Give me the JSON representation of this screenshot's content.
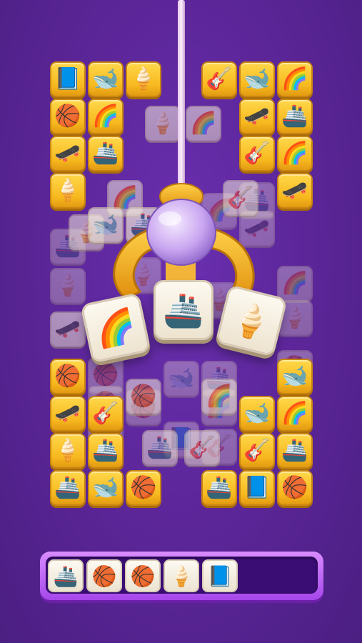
{
  "board": {
    "tiles": [
      {
        "icon": "book",
        "glyph": "📘",
        "kind": "gold",
        "pos": "r0c0"
      },
      {
        "icon": "whale",
        "glyph": "🐋",
        "kind": "gold",
        "pos": "r0c1"
      },
      {
        "icon": "ice-cream",
        "glyph": "🍦",
        "kind": "gold",
        "pos": "r0c2"
      },
      {
        "icon": "guitar",
        "glyph": "🎸",
        "kind": "gold",
        "pos": "r0c4"
      },
      {
        "icon": "whale",
        "glyph": "🐋",
        "kind": "gold",
        "pos": "r0c5"
      },
      {
        "icon": "rainbow",
        "glyph": "🌈",
        "kind": "gold",
        "pos": "r0c6"
      },
      {
        "icon": "basketball",
        "glyph": "🏀",
        "kind": "gold",
        "pos": "r1c0"
      },
      {
        "icon": "rainbow",
        "glyph": "🌈",
        "kind": "gold",
        "pos": "r1c1"
      },
      {
        "icon": "skateboard",
        "glyph": "🛹",
        "kind": "gold",
        "pos": "r1c5"
      },
      {
        "icon": "boat",
        "glyph": "🚢",
        "kind": "gold",
        "pos": "r1c6"
      },
      {
        "icon": "skateboard",
        "glyph": "🛹",
        "kind": "gold",
        "pos": "r2c0"
      },
      {
        "icon": "boat",
        "glyph": "🚢",
        "kind": "gold",
        "pos": "r2c1"
      },
      {
        "icon": "guitar",
        "glyph": "🎸",
        "kind": "gold",
        "pos": "r2c5"
      },
      {
        "icon": "rainbow",
        "glyph": "🌈",
        "kind": "gold",
        "pos": "r2c6"
      },
      {
        "icon": "ice-cream",
        "glyph": "🍦",
        "kind": "gold",
        "pos": "r3c0"
      },
      {
        "icon": "skateboard",
        "glyph": "🛹",
        "kind": "gold",
        "pos": "r3c6"
      },
      {
        "icon": "basketball",
        "glyph": "🏀",
        "kind": "gold",
        "pos": "r8c0"
      },
      {
        "icon": "whale",
        "glyph": "🐋",
        "kind": "gold",
        "pos": "r8c6"
      },
      {
        "icon": "skateboard",
        "glyph": "🛹",
        "kind": "gold",
        "pos": "r9c0"
      },
      {
        "icon": "guitar",
        "glyph": "🎸",
        "kind": "gold",
        "pos": "r9c1"
      },
      {
        "icon": "whale",
        "glyph": "🐋",
        "kind": "gold",
        "pos": "r9c5"
      },
      {
        "icon": "rainbow",
        "glyph": "🌈",
        "kind": "gold",
        "pos": "r9c6"
      },
      {
        "icon": "ice-cream",
        "glyph": "🍦",
        "kind": "gold",
        "pos": "r10c0"
      },
      {
        "icon": "boat",
        "glyph": "🚢",
        "kind": "gold",
        "pos": "r10c1"
      },
      {
        "icon": "guitar",
        "glyph": "🎸",
        "kind": "gold",
        "pos": "r10c5"
      },
      {
        "icon": "boat",
        "glyph": "🚢",
        "kind": "gold",
        "pos": "r10c6"
      },
      {
        "icon": "boat",
        "glyph": "🚢",
        "kind": "gold",
        "pos": "r11c0"
      },
      {
        "icon": "whale",
        "glyph": "🐋",
        "kind": "gold",
        "pos": "r11c1"
      },
      {
        "icon": "basketball",
        "glyph": "🏀",
        "kind": "gold",
        "pos": "r11c2"
      },
      {
        "icon": "boat",
        "glyph": "🚢",
        "kind": "gold",
        "pos": "r11c4"
      },
      {
        "icon": "book",
        "glyph": "📘",
        "kind": "gold",
        "pos": "r11c5"
      },
      {
        "icon": "basketball",
        "glyph": "🏀",
        "kind": "gold",
        "pos": "r11c6"
      }
    ],
    "covered_tiles": [
      {
        "icon": "ice-cream",
        "glyph": "🍦",
        "pos": "a1"
      },
      {
        "icon": "rainbow",
        "glyph": "🌈",
        "pos": "a2"
      },
      {
        "icon": "rainbow",
        "glyph": "🌈",
        "pos": "a3"
      },
      {
        "icon": "guitar",
        "glyph": "🎸",
        "pos": "a4"
      },
      {
        "icon": "ice-cream",
        "glyph": "🍦",
        "pos": "a5"
      },
      {
        "icon": "boat",
        "glyph": "🚢",
        "pos": "a6"
      },
      {
        "icon": "whale",
        "glyph": "🐋",
        "pos": "a7"
      },
      {
        "icon": "basketball",
        "glyph": "🏀",
        "pos": "a8"
      },
      {
        "icon": "rainbow",
        "glyph": "🌈",
        "pos": "a9"
      },
      {
        "icon": "boat",
        "glyph": "🚢",
        "pos": "a10"
      },
      {
        "icon": "guitar",
        "glyph": "🎸",
        "pos": "a11"
      }
    ],
    "faded_tiles": [
      {
        "icon": "ice-cream",
        "glyph": "🍦",
        "pos": "b1"
      },
      {
        "icon": "skateboard",
        "glyph": "🛹",
        "pos": "b2"
      },
      {
        "icon": "rainbow",
        "glyph": "🌈",
        "pos": "b3"
      },
      {
        "icon": "book",
        "glyph": "📘",
        "pos": "b4"
      },
      {
        "icon": "basketball",
        "glyph": "🏀",
        "pos": "b5"
      },
      {
        "icon": "ice-cream",
        "glyph": "🍦",
        "pos": "b6"
      },
      {
        "icon": "skateboard",
        "glyph": "🛹",
        "pos": "b7"
      },
      {
        "icon": "boat",
        "glyph": "🚢",
        "pos": "b8"
      },
      {
        "icon": "basketball",
        "glyph": "🏀",
        "pos": "b9"
      },
      {
        "icon": "whale",
        "glyph": "🐋",
        "pos": "b10"
      },
      {
        "icon": "basketball",
        "glyph": "🏀",
        "pos": "b11"
      },
      {
        "icon": "guitar",
        "glyph": "🎸",
        "pos": "b12"
      },
      {
        "icon": "rainbow",
        "glyph": "🌈",
        "pos": "b13"
      },
      {
        "icon": "book",
        "glyph": "📘",
        "pos": "b14"
      },
      {
        "icon": "whale",
        "glyph": "🐋",
        "pos": "b15"
      },
      {
        "icon": "basketball",
        "glyph": "🏀",
        "pos": "b16"
      },
      {
        "icon": "boat",
        "glyph": "🚢",
        "pos": "b17"
      },
      {
        "icon": "ice-cream",
        "glyph": "🍦",
        "pos": "b18"
      },
      {
        "icon": "skateboard",
        "glyph": "🛹",
        "pos": "b19"
      },
      {
        "icon": "boat",
        "glyph": "🚢",
        "pos": "b20"
      },
      {
        "icon": "rainbow",
        "glyph": "🌈",
        "pos": "b21"
      },
      {
        "icon": "whale",
        "glyph": "🐋",
        "pos": "b22"
      },
      {
        "icon": "boat",
        "glyph": "🚢",
        "pos": "b23"
      },
      {
        "icon": "ice-cream",
        "glyph": "🍦",
        "pos": "b24"
      }
    ]
  },
  "claw": {
    "held_tiles": [
      {
        "icon": "rainbow",
        "glyph": "🌈"
      },
      {
        "icon": "boat",
        "glyph": "🚢"
      },
      {
        "icon": "ice-cream",
        "glyph": "🍦"
      }
    ]
  },
  "tray": {
    "capacity": 7,
    "slots": [
      {
        "icon": "boat",
        "glyph": "🚢"
      },
      {
        "icon": "basketball",
        "glyph": "🏀"
      },
      {
        "icon": "basketball",
        "glyph": "🏀"
      },
      {
        "icon": "ice-cream",
        "glyph": "🍦"
      },
      {
        "icon": "book",
        "glyph": "📘"
      }
    ]
  },
  "colors": {
    "background": "#5a2596",
    "tile_gold": "#f7b81e",
    "tile_cream": "#efe5d3",
    "tray_border": "#a647ea",
    "tray_fill": "#3a0d74"
  }
}
